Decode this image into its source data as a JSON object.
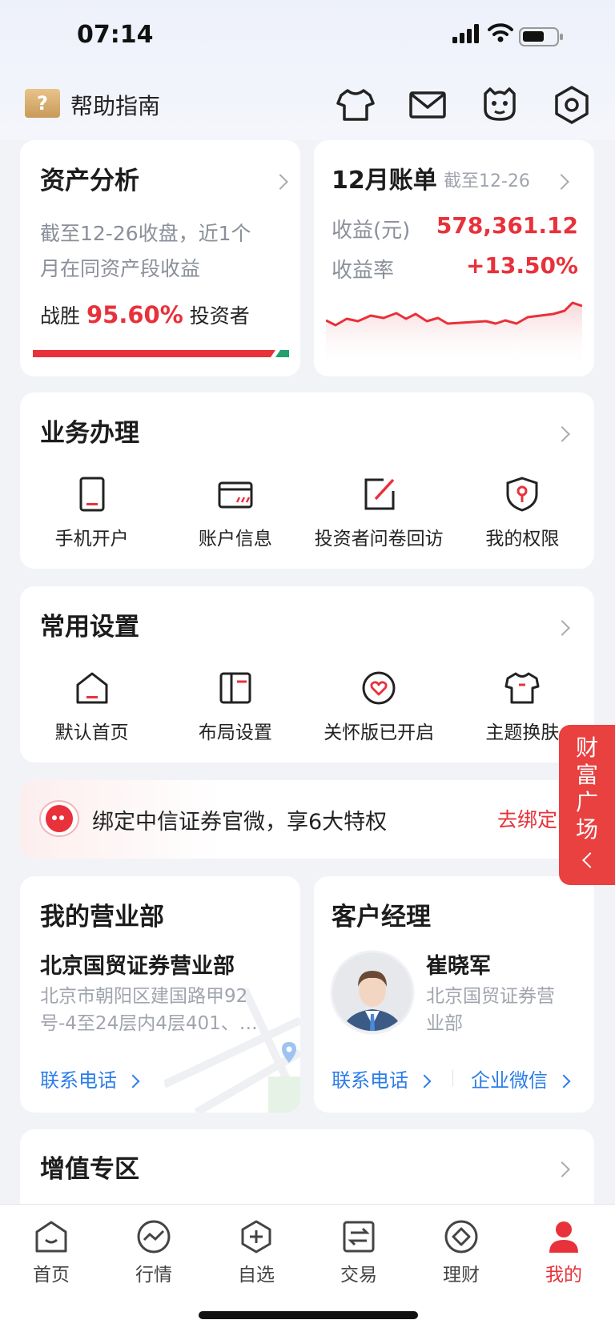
{
  "status_bar": {
    "time": "07:14"
  },
  "header": {
    "help_label": "帮助指南",
    "help_icon_glyph": "?"
  },
  "asset_analysis": {
    "title": "资产分析",
    "desc_line1": "截至12-26收盘，近1个",
    "desc_line2": "月在同资产段收益",
    "beat_prefix": "战胜",
    "beat_value": "95.60%",
    "beat_suffix": "投资者",
    "beat_fraction": 0.956
  },
  "bill": {
    "title": "12月账单",
    "date": "截至12-26",
    "profit_label": "收益(元)",
    "profit_value": "578,361.12",
    "rate_label": "收益率",
    "rate_value": "+13.50%"
  },
  "business": {
    "title": "业务办理",
    "items": [
      {
        "label": "手机开户",
        "icon": "phone-icon"
      },
      {
        "label": "账户信息",
        "icon": "card-icon"
      },
      {
        "label": "投资者问卷回访",
        "icon": "edit-icon"
      },
      {
        "label": "我的权限",
        "icon": "shield-key-icon"
      }
    ]
  },
  "settings": {
    "title": "常用设置",
    "items": [
      {
        "label": "默认首页",
        "icon": "home-icon"
      },
      {
        "label": "布局设置",
        "icon": "layout-icon"
      },
      {
        "label": "关怀版已开启",
        "icon": "heart-icon"
      },
      {
        "label": "主题换肤",
        "icon": "shirt-icon"
      }
    ]
  },
  "bind_banner": {
    "text": "绑定中信证券官微，享6大特权",
    "action": "去绑定"
  },
  "branch": {
    "title": "我的营业部",
    "name": "北京国贸证券营业部",
    "address_line1": "北京市朝阳区建国路甲92",
    "address_line2": "号-4至24层内4层401、…",
    "contact": "联系电话"
  },
  "manager": {
    "title": "客户经理",
    "name": "崔晓军",
    "branch_line1": "北京国贸证券营",
    "branch_line2": "业部",
    "contact": "联系电话",
    "wechat": "企业微信"
  },
  "value_zone": {
    "title": "增值专区"
  },
  "floating": {
    "chars": [
      "财",
      "富",
      "广",
      "场"
    ]
  },
  "tabbar": {
    "items": [
      {
        "label": "首页",
        "icon": "home-tab-icon"
      },
      {
        "label": "行情",
        "icon": "market-icon"
      },
      {
        "label": "自选",
        "icon": "add-watch-icon"
      },
      {
        "label": "交易",
        "icon": "trade-icon"
      },
      {
        "label": "理财",
        "icon": "wealth-icon"
      },
      {
        "label": "我的",
        "icon": "profile-icon"
      }
    ],
    "active": "我的"
  },
  "colors": {
    "accent_red": "#e8313a",
    "link_blue": "#2b7de9",
    "green": "#23a06b"
  }
}
